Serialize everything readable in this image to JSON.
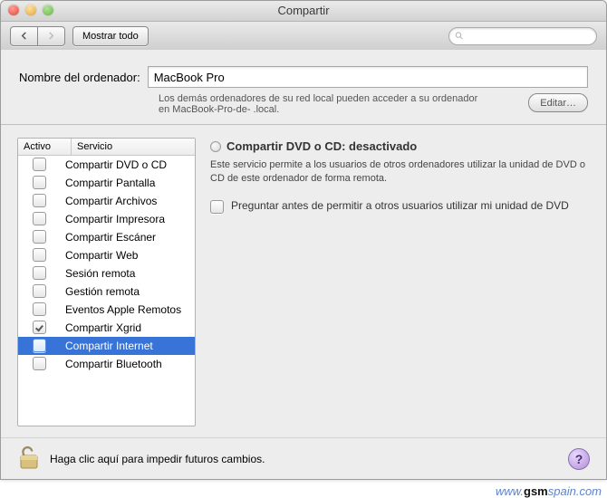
{
  "header": {
    "title": "Compartir"
  },
  "toolbar": {
    "show_all": "Mostrar todo",
    "search_placeholder": ""
  },
  "computer_name": {
    "label": "Nombre del ordenador:",
    "value": "MacBook Pro",
    "hint1": "Los demás ordenadores de su red local pueden acceder a su ordenador",
    "hint2": "en MacBook-Pro-de-                           .local.",
    "edit": "Editar…"
  },
  "services": {
    "col_active": "Activo",
    "col_service": "Servicio",
    "rows": [
      {
        "label": "Compartir DVD o CD",
        "checked": false,
        "selected": false
      },
      {
        "label": "Compartir Pantalla",
        "checked": false,
        "selected": false
      },
      {
        "label": "Compartir Archivos",
        "checked": false,
        "selected": false
      },
      {
        "label": "Compartir Impresora",
        "checked": false,
        "selected": false
      },
      {
        "label": "Compartir Escáner",
        "checked": false,
        "selected": false
      },
      {
        "label": "Compartir Web",
        "checked": false,
        "selected": false
      },
      {
        "label": "Sesión remota",
        "checked": false,
        "selected": false
      },
      {
        "label": "Gestión remota",
        "checked": false,
        "selected": false
      },
      {
        "label": "Eventos Apple Remotos",
        "checked": false,
        "selected": false
      },
      {
        "label": "Compartir Xgrid",
        "checked": true,
        "selected": false
      },
      {
        "label": "Compartir Internet",
        "checked": false,
        "selected": true
      },
      {
        "label": "Compartir Bluetooth",
        "checked": false,
        "selected": false
      }
    ]
  },
  "detail": {
    "title": "Compartir DVD o CD: desactivado",
    "description": "Este servicio permite a los usuarios de otros ordenadores utilizar la unidad de DVD o CD de este ordenador de forma remota.",
    "option_label": "Preguntar antes de permitir a otros usuarios utilizar mi unidad de DVD"
  },
  "footer": {
    "lock_text": "Haga clic aquí para impedir futuros cambios."
  },
  "watermark": {
    "prefix": "www.",
    "bold": "gsm",
    "suffix": "spain.com"
  }
}
